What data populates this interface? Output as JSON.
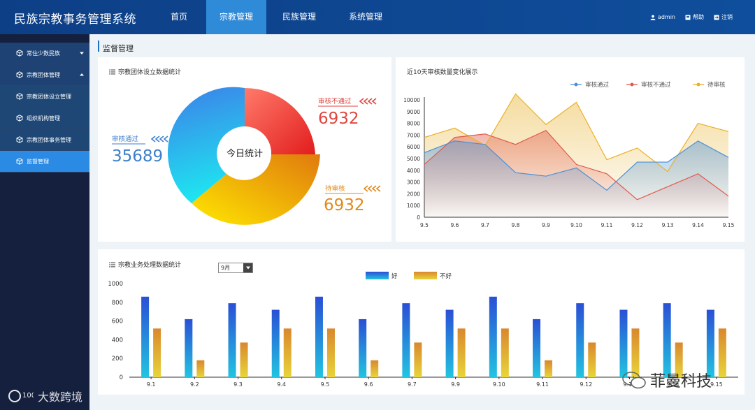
{
  "app": {
    "title": "民族宗教事务管理系统"
  },
  "nav": [
    {
      "label": "首页",
      "active": false
    },
    {
      "label": "宗教管理",
      "active": true
    },
    {
      "label": "民族管理",
      "active": false
    },
    {
      "label": "系统管理",
      "active": false
    }
  ],
  "user_links": [
    {
      "label": "admin",
      "icon": "user-icon"
    },
    {
      "label": "帮助",
      "icon": "help-icon"
    },
    {
      "label": "注销",
      "icon": "logout-icon"
    }
  ],
  "sidebar": {
    "items": [
      {
        "label": "常住少数民族",
        "type": "group",
        "expanded": false
      },
      {
        "label": "宗教团体管理",
        "type": "group",
        "expanded": true
      },
      {
        "label": "宗教团体设立管理",
        "type": "sub"
      },
      {
        "label": "组织机构管理",
        "type": "sub"
      },
      {
        "label": "宗教团体事务管理",
        "type": "sub"
      },
      {
        "label": "监督管理",
        "type": "sub",
        "active": true
      }
    ]
  },
  "page": {
    "title": "监督管理"
  },
  "donut_panel": {
    "title": "宗教团体设立数据统计",
    "center_label": "今日统计",
    "approved": {
      "label": "审核通过",
      "value": "35689",
      "color": "#3d7fcc"
    },
    "rejected": {
      "label": "审核不通过",
      "value": "6932",
      "color": "#e0463f"
    },
    "pending": {
      "label": "待审核",
      "value": "6932",
      "color": "#e08a1c"
    }
  },
  "line_panel": {
    "title": "近10天审核数量变化展示",
    "chart_data": {
      "type": "area",
      "x": [
        "9.5",
        "9.6",
        "9.7",
        "9.8",
        "9.9",
        "9.10",
        "9.11",
        "9.12",
        "9.13",
        "9.14",
        "9.15"
      ],
      "ylim": [
        0,
        10000
      ],
      "yticks": [
        0,
        1000,
        2000,
        3000,
        4000,
        5000,
        6000,
        7000,
        8000,
        9000,
        10000
      ],
      "legend_position": "top-right",
      "series": [
        {
          "name": "审核通过",
          "color": "#4a90d9",
          "values": [
            5500,
            6500,
            6200,
            3800,
            3500,
            4200,
            2300,
            4700,
            4700,
            6500,
            5100
          ]
        },
        {
          "name": "审核不通过",
          "color": "#e05a4e",
          "values": [
            4500,
            6800,
            7100,
            6200,
            7400,
            4500,
            3700,
            1500,
            2600,
            3700,
            1800
          ]
        },
        {
          "name": "待审核",
          "color": "#e8b12a",
          "values": [
            6800,
            7600,
            6100,
            10500,
            7900,
            9800,
            4900,
            5900,
            3900,
            8000,
            7300
          ]
        }
      ]
    }
  },
  "bar_panel": {
    "title": "宗教业务处理数据统计",
    "month_select": "9月",
    "chart_data": {
      "type": "bar",
      "categories": [
        "9.1",
        "9.2",
        "9.3",
        "9.4",
        "9.5",
        "9.6",
        "9.7",
        "9.9",
        "9.10",
        "9.11",
        "9.12",
        "9.13",
        "9.14",
        "9.15"
      ],
      "ylim": [
        0,
        1000
      ],
      "yticks": [
        0,
        200,
        400,
        600,
        800,
        1000
      ],
      "legend_position": "top-center",
      "series": [
        {
          "name": "好",
          "color": "#2b5fd6",
          "values": [
            860,
            620,
            790,
            720,
            860,
            620,
            790,
            720,
            860,
            620,
            790,
            720,
            790,
            720
          ]
        },
        {
          "name": "不好",
          "color": "#e2a53a",
          "values": [
            520,
            180,
            370,
            520,
            520,
            180,
            370,
            520,
            520,
            180,
            370,
            520,
            370,
            520
          ]
        }
      ]
    }
  },
  "watermarks": [
    "大数跨境",
    "菲曼科技"
  ],
  "colors": {
    "header": "#0f4e9c",
    "nav_active": "#2f8ad8",
    "sidebar": "#14203d",
    "sidebar_group": "#1d4273",
    "sidebar_active": "#2a8ae4"
  }
}
